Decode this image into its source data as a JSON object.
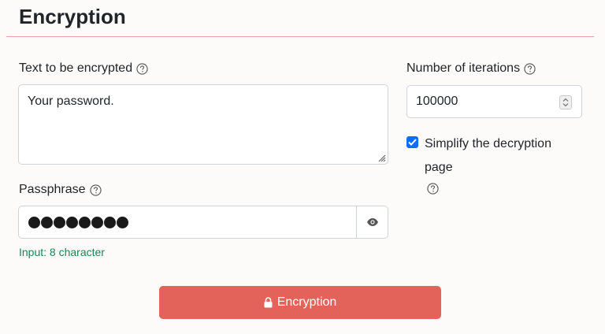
{
  "page": {
    "title": "Encryption"
  },
  "text_field": {
    "label": "Text to be encrypted",
    "value": "Your password."
  },
  "passphrase": {
    "label": "Passphrase",
    "masked_length": 8,
    "hint": "Input: 8 character"
  },
  "iterations": {
    "label": "Number of iterations",
    "value": "100000"
  },
  "simplify": {
    "label": "Simplify the decryption page",
    "checked": true
  },
  "encrypt_button": {
    "label": "Encryption",
    "color": "#e3625a"
  },
  "icons": {
    "help": "question-circle-icon",
    "eye": "eye-icon",
    "lock": "lock-icon",
    "check": "check-icon"
  },
  "colors": {
    "accent": "#0d6efd",
    "hint": "#198754",
    "rule": "#e8a0a0"
  }
}
